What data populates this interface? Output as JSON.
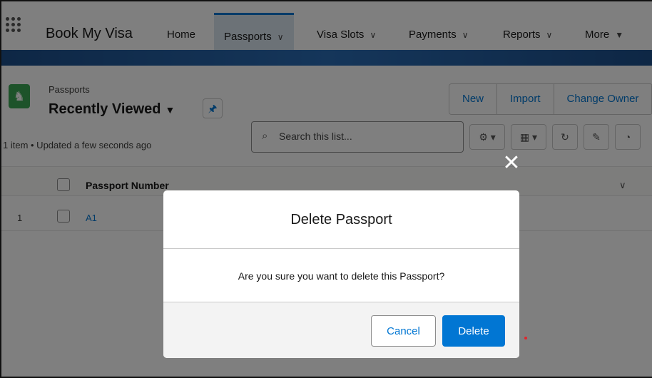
{
  "app": {
    "name": "Book My Visa"
  },
  "nav": {
    "items": [
      {
        "label": "Home"
      },
      {
        "label": "Passports"
      },
      {
        "label": "Visa Slots"
      },
      {
        "label": "Payments"
      },
      {
        "label": "Reports"
      },
      {
        "label": "More"
      }
    ],
    "active": "Passports"
  },
  "list": {
    "object_label": "Passports",
    "view_title": "Recently Viewed",
    "meta": "1 item • Updated a few seconds ago",
    "actions": [
      {
        "label": "New"
      },
      {
        "label": "Import"
      },
      {
        "label": "Change Owner"
      }
    ],
    "search": {
      "placeholder": "Search this list..."
    },
    "columns": [
      {
        "label": "Passport Number"
      }
    ],
    "rows": [
      {
        "num": "1",
        "passport_number": "A1"
      }
    ]
  },
  "modal": {
    "title": "Delete Passport",
    "message": "Are you sure you want to delete this Passport?",
    "cancel_label": "Cancel",
    "delete_label": "Delete"
  },
  "colors": {
    "brand": "#0176d3",
    "object_icon": "#3ba755"
  }
}
